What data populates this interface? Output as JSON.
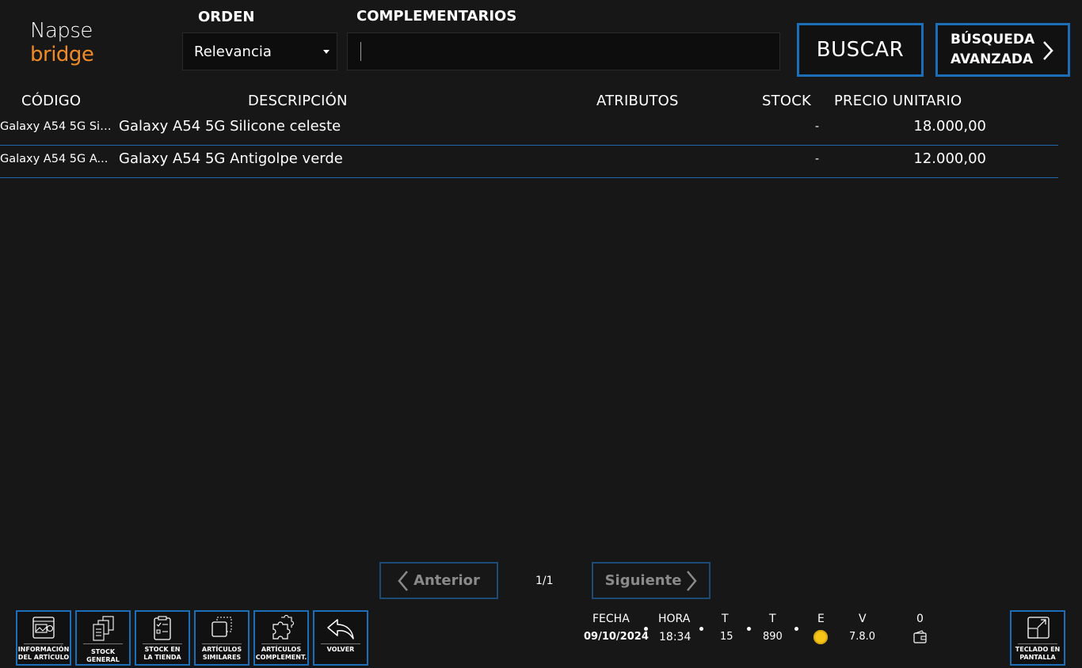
{
  "logo": {
    "line1": "Napse",
    "line2": "bridge"
  },
  "header": {
    "orden_label": "ORDEN",
    "complementarios_label": "COMPLEMENTARIOS",
    "orden_value": "Relevancia",
    "search_value": "",
    "buscar_label": "BUSCAR",
    "avanzada_line1": "BÚSQUEDA",
    "avanzada_line2": "AVANZADA"
  },
  "table": {
    "columns": [
      "CÓDIGO",
      "DESCRIPCIÓN",
      "ATRIBUTOS",
      "STOCK",
      "PRECIO UNITARIO"
    ],
    "rows": [
      {
        "code": "Galaxy A54 5G Sil...",
        "desc": "Galaxy A54 5G Silicone celeste",
        "attr": "",
        "stock": "-",
        "price": "18.000,00"
      },
      {
        "code": "Galaxy A54 5G A...",
        "desc": "Galaxy A54 5G Antigolpe verde",
        "attr": "",
        "stock": "-",
        "price": "12.000,00"
      }
    ]
  },
  "pager": {
    "prev": "Anterior",
    "page": "1/1",
    "next": "Siguiente"
  },
  "toolbar": [
    {
      "l1": "INFORMACIÓN",
      "l2": "DEL ARTÍCULO",
      "icon": "article-info-icon"
    },
    {
      "l1": "STOCK",
      "l2": "GENERAL",
      "icon": "stock-general-icon"
    },
    {
      "l1": "STOCK EN",
      "l2": "LA TIENDA",
      "icon": "store-stock-icon"
    },
    {
      "l1": "ARTÍCULOS",
      "l2": "SIMILARES",
      "icon": "similar-items-icon"
    },
    {
      "l1": "ARTÍCULOS",
      "l2": "COMPLEMENT.",
      "icon": "puzzle-icon"
    },
    {
      "l1": "VOLVER",
      "l2": "",
      "icon": "back-arrow-icon"
    }
  ],
  "status": {
    "fecha_label": "FECHA",
    "fecha": "09/10/2024",
    "hora_label": "HORA",
    "hora": "18:34",
    "t1_label": "T",
    "t1": "15",
    "t2_label": "T",
    "t2": "890",
    "e_label": "E",
    "v_label": "V",
    "v": "7.8.0",
    "count": "0"
  },
  "keyboard": {
    "l1": "TECLADO EN",
    "l2": "PANTALLA",
    "icon": "expand-icon"
  },
  "colors": {
    "accent": "#1d6eb8",
    "logo_orange": "#f08a24",
    "status_coin": "#f5c518"
  }
}
